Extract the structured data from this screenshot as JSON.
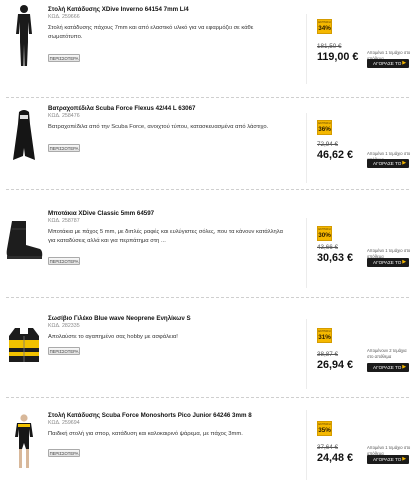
{
  "products": [
    {
      "title": "Στολή Κατάδυσης XDive Inverno 64154 7mm L/4",
      "code": "ΚΩΔ. 259666",
      "description": "Στολή κατάδυσης πάχους 7mm και από ελαστικό υλικό για να εφαρμόζει σε κάθε σωματότυπο.",
      "more_label": "ΠΕΡΙΣΣΟΤΕΡΑ",
      "badge_label": "ΕΚΠΤΩΣΗ",
      "discount": "34%",
      "old_price": "181,50 €",
      "new_price": "119,00 €",
      "availability": "Απομένει 1 τεμάχιο στο απόθεμα",
      "buy_label": "ΑΓΟΡΑΣΕ ΤΟ",
      "image_icon": "wetsuit-full-icon"
    },
    {
      "title": "Βατραχοπέδιλα Scuba Force Flexus 42/44 L 63067",
      "code": "ΚΩΔ. 258476",
      "description": "Βατραχοπέδιλα από την Scuba Force, ανοιχτού τύπου, κατασκευασμένα από λάστιχο.",
      "more_label": "ΠΕΡΙΣΣΟΤΕΡΑ",
      "badge_label": "ΕΚΠΤΩΣΗ",
      "discount": "36%",
      "old_price": "72,94 €",
      "new_price": "46,62 €",
      "availability": "Απομένει 1 τεμάχιο στο απόθεμα",
      "buy_label": "ΑΓΟΡΑΣΕ ΤΟ",
      "image_icon": "diving-fin-icon"
    },
    {
      "title": "Μποτάκια XDive Classic 5mm 64597",
      "code": "ΚΩΔ. 258787",
      "description": "Μποτάκια με πάχος 5 mm, με διπλές ραφές και ευλύγιστες σόλες, που τα κάνουν κατάλληλα για καταδύσεις αλλά και για περπάτημα στη ...",
      "more_label": "ΠΕΡΙΣΣΟΤΕΡΑ",
      "badge_label": "ΕΚΠΤΩΣΗ",
      "discount": "30%",
      "old_price": "43,66 €",
      "new_price": "30,63 €",
      "availability": "Απομένει 1 τεμάχιο στο απόθεμα",
      "buy_label": "ΑΓΟΡΑΣΕ ΤΟ",
      "image_icon": "dive-boot-icon"
    },
    {
      "title": "Σωσίβιο Γιλέκο Blue wave Neoprene Ενηλίκων S",
      "code": "ΚΩΔ. 282335",
      "description": "Απολαύστε το αγαπημένο σας hobby με ασφάλεια!",
      "more_label": "ΠΕΡΙΣΣΟΤΕΡΑ",
      "badge_label": "ΕΚΠΤΩΣΗ",
      "discount": "31%",
      "old_price": "38,87 €",
      "new_price": "26,94 €",
      "availability": "Απομένουν 2 τεμάχια στο απόθεμα",
      "buy_label": "ΑΓΟΡΑΣΕ ΤΟ",
      "image_icon": "life-vest-icon"
    },
    {
      "title": "Στολή Κατάδυσης Scuba Force Monoshorts Pico Junior 64246 3mm 8",
      "code": "ΚΩΔ. 259694",
      "description": "Παιδική στολή για σπορ, κατάδυση και καλοκαιρινό ψάρεμα, με πάχος 3mm.",
      "more_label": "ΠΕΡΙΣΣΟΤΕΡΑ",
      "badge_label": "ΕΚΠΤΩΣΗ",
      "discount": "35%",
      "old_price": "37,64 €",
      "new_price": "24,48 €",
      "availability": "Απομένει 1 τεμάχιο στο απόθεμα",
      "buy_label": "ΑΓΟΡΑΣΕ ΤΟ",
      "image_icon": "shorty-wetsuit-icon"
    }
  ],
  "colors": {
    "badge": "#f5b800",
    "buy_button": "#1b1b1b",
    "divider": "#cfcfcf"
  }
}
